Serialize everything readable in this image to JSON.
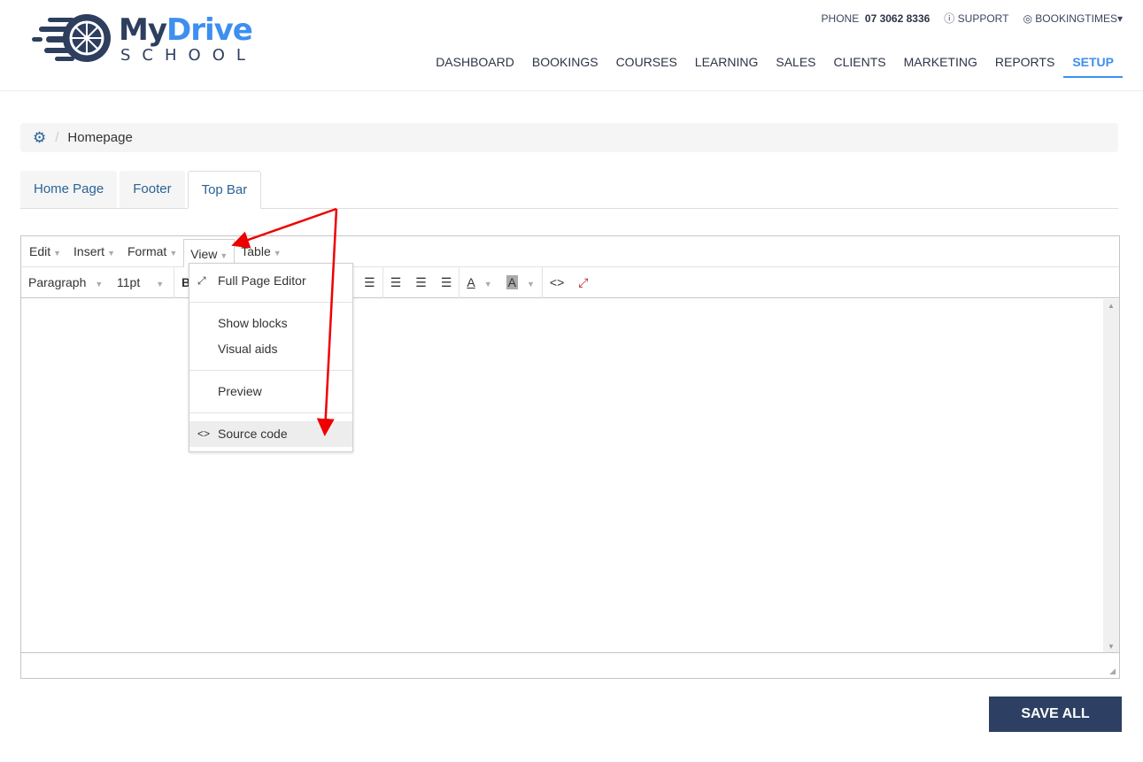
{
  "brand": {
    "name_part1": "My",
    "name_part2": "Drive",
    "subtitle": "SCHOOL",
    "colors": {
      "navy": "#2d3e5e",
      "blue": "#3d8ff0"
    }
  },
  "topinfo": {
    "phone_label": "PHONE",
    "phone_number": "07 3062 8336",
    "support": "SUPPORT",
    "account": "BOOKINGTIMES"
  },
  "nav": [
    "DASHBOARD",
    "BOOKINGS",
    "COURSES",
    "LEARNING",
    "SALES",
    "CLIENTS",
    "MARKETING",
    "REPORTS",
    "SETUP"
  ],
  "nav_active": "SETUP",
  "breadcrumb": {
    "icon": "gear-icon",
    "sep": "/",
    "current": "Homepage"
  },
  "tabs": [
    "Home Page",
    "Footer",
    "Top Bar"
  ],
  "tabs_active": "Top Bar",
  "editor": {
    "menu": [
      "Edit",
      "Insert",
      "Format",
      "View",
      "Table"
    ],
    "toolbar": {
      "block": "Paragraph",
      "size": "11pt",
      "bold": "B",
      "color_a": "A",
      "code": "<>"
    },
    "view_menu": {
      "full_page": "Full Page Editor",
      "show_blocks": "Show blocks",
      "visual_aids": "Visual aids",
      "preview": "Preview",
      "source_code": "Source code"
    }
  },
  "save_label": "SAVE ALL"
}
